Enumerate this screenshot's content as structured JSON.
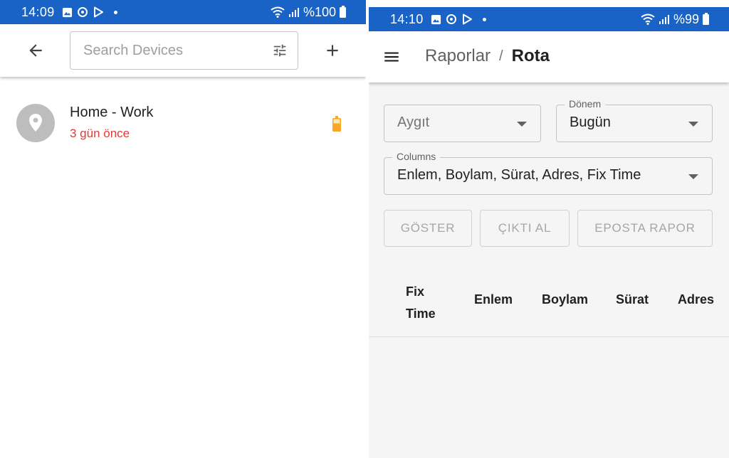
{
  "left": {
    "status_bar": {
      "time": "14:09",
      "battery": "%100"
    },
    "app_bar": {
      "back_icon": "arrow-left-icon",
      "search_placeholder": "Search Devices",
      "filter_icon": "tune-icon",
      "add_icon": "plus-icon"
    },
    "devices": [
      {
        "name": "Home - Work",
        "status": "3 gün önce",
        "icon": "map-pin-icon",
        "battery_color": "#f9a825"
      }
    ]
  },
  "right": {
    "status_bar": {
      "time": "14:10",
      "battery": "%99"
    },
    "app_bar": {
      "menu_icon": "hamburger-menu-icon",
      "breadcrumb_parent": "Raporlar",
      "breadcrumb_separator": "/",
      "breadcrumb_current": "Rota"
    },
    "filters": {
      "device_placeholder": "Aygıt",
      "period_label": "Dönem",
      "period_value": "Bugün",
      "columns_label": "Columns",
      "columns_value": "Enlem, Boylam, Sürat, Adres, Fix Time"
    },
    "buttons": {
      "show": "GÖSTER",
      "export": "ÇIKTI AL",
      "email": "EPOSTA RAPOR"
    },
    "table_headers": [
      "Fix Time",
      "Enlem",
      "Boylam",
      "Sürat",
      "Adres"
    ]
  },
  "colors": {
    "status_bar": "#1a63c6",
    "status_text": "#e53935",
    "battery_indicator": "#f9a825"
  }
}
